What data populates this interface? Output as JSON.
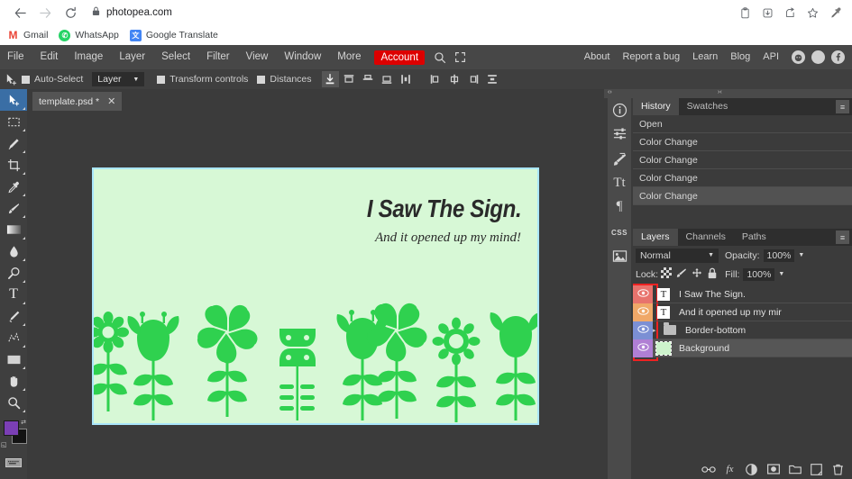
{
  "browser": {
    "url": "photopea.com",
    "nav": {
      "back_icon": "back-arrow-icon",
      "forward_icon": "forward-arrow-icon",
      "reload_icon": "reload-icon",
      "lock_icon": "lock-icon"
    },
    "omni_actions": [
      "clipboard-icon",
      "install-app-icon",
      "share-icon",
      "bookmark-star-icon",
      "eyedropper-icon"
    ],
    "bookmarks": [
      {
        "label": "Gmail",
        "icon": "gmail-icon",
        "glyph": "M"
      },
      {
        "label": "WhatsApp",
        "icon": "whatsapp-icon",
        "glyph": "✆"
      },
      {
        "label": "Google Translate",
        "icon": "google-translate-icon",
        "glyph": "文"
      }
    ]
  },
  "menubar": {
    "items": [
      "File",
      "Edit",
      "Image",
      "Layer",
      "Select",
      "Filter",
      "View",
      "Window",
      "More"
    ],
    "account": "Account",
    "account_color": "#dd0000",
    "icons": [
      "search-icon",
      "fullscreen-icon"
    ],
    "right_items": [
      "About",
      "Report a bug",
      "Learn",
      "Blog",
      "API"
    ],
    "social": [
      {
        "name": "reddit-icon",
        "glyph": "◉"
      },
      {
        "name": "twitter-icon",
        "glyph": "✈"
      },
      {
        "name": "facebook-icon",
        "glyph": "f"
      }
    ]
  },
  "options_bar": {
    "tool_icon": "move-tool-icon",
    "auto_select_label": "Auto-Select",
    "layer_scope": "Layer",
    "transform_controls_label": "Transform controls",
    "distances_label": "Distances",
    "align_icons": [
      "align-distribute-icon",
      "align-top-icon",
      "align-vcenter-icon",
      "align-bottom-icon",
      "distribute-vertical-icon",
      "align-left-icon",
      "align-hcenter-icon",
      "align-right-icon",
      "distribute-horizontal-icon"
    ]
  },
  "toolbar": {
    "tools": [
      {
        "name": "move-tool",
        "glyph": "✥",
        "active": true
      },
      {
        "name": "marquee-tool",
        "glyph": "▢",
        "active": false
      },
      {
        "name": "lasso-tool",
        "glyph": "✦",
        "active": false
      },
      {
        "name": "crop-tool",
        "glyph": "⌗",
        "active": false
      },
      {
        "name": "eyedropper-tool",
        "glyph": "✇",
        "active": false
      },
      {
        "name": "brush-tool",
        "glyph": "✎",
        "active": false
      },
      {
        "name": "gradient-tool",
        "glyph": "▦",
        "active": false
      },
      {
        "name": "blur-tool",
        "glyph": "💧",
        "active": false
      },
      {
        "name": "dodge-tool",
        "glyph": "🔍",
        "active": false
      },
      {
        "name": "text-tool",
        "glyph": "T",
        "active": false
      },
      {
        "name": "pen-tool",
        "glyph": "✒",
        "active": false
      },
      {
        "name": "shape-tool",
        "glyph": "✧",
        "active": false
      },
      {
        "name": "rectangle-tool",
        "glyph": "▬",
        "active": false
      },
      {
        "name": "hand-tool",
        "glyph": "✋",
        "active": false
      },
      {
        "name": "zoom-tool",
        "glyph": "🔎",
        "active": false
      }
    ],
    "foreground_color": "#7b3fb5",
    "background_color": "#131313",
    "keyboard_icon": "keyboard-icon"
  },
  "document": {
    "tab_label": "template.psd *",
    "close_glyph": "✕"
  },
  "canvas": {
    "headline": "I Saw The Sign.",
    "subline": "And it opened up my mind!",
    "background_color": "#d7f8d6",
    "flower_color": "#2fd14f",
    "selection_border_color": "#a9e6fb"
  },
  "right_panel": {
    "rail_icons": [
      "info-icon",
      "adjustments-icon",
      "brush-settings-icon",
      "character-icon",
      "paragraph-icon",
      "css-icon",
      "image-icon"
    ],
    "collapse_glyph": "›‹",
    "expand_glyph": "‹›",
    "menu_glyph": "≡",
    "history": {
      "tabs": [
        {
          "label": "History",
          "active": true
        },
        {
          "label": "Swatches",
          "active": false
        }
      ],
      "rows": [
        {
          "label": "Open",
          "selected": false
        },
        {
          "label": "Color Change",
          "selected": false
        },
        {
          "label": "Color Change",
          "selected": false
        },
        {
          "label": "Color Change",
          "selected": false
        },
        {
          "label": "Color Change",
          "selected": true
        }
      ]
    },
    "layers": {
      "tabs": [
        {
          "label": "Layers",
          "active": true
        },
        {
          "label": "Channels",
          "active": false
        },
        {
          "label": "Paths",
          "active": false
        }
      ],
      "blend_mode": "Normal",
      "opacity_label": "Opacity:",
      "opacity_value": "100%",
      "lock_label": "Lock:",
      "lock_icons": [
        "lock-transparency-icon",
        "lock-pixels-icon",
        "lock-position-icon",
        "lock-all-icon"
      ],
      "fill_label": "Fill:",
      "fill_value": "100%",
      "rows": [
        {
          "name": "I Saw The Sign.",
          "kind": "text",
          "eye_color": "#e8736d",
          "selected": false,
          "has_disclosure": false
        },
        {
          "name": "And it opened up my mir",
          "kind": "text",
          "eye_color": "#f0a868",
          "selected": false,
          "has_disclosure": false
        },
        {
          "name": "Border-bottom",
          "kind": "folder",
          "eye_color": "#7b8fd4",
          "selected": false,
          "has_disclosure": true
        },
        {
          "name": "Background",
          "kind": "image",
          "eye_color": "#b07fd4",
          "selected": true,
          "has_disclosure": false
        }
      ],
      "highlight_color": "#ee2222",
      "bottom_icons": [
        {
          "name": "link-layers-icon",
          "glyph": "∞"
        },
        {
          "name": "layer-effects-icon",
          "glyph": "ƒx"
        },
        {
          "name": "adjustment-layer-icon",
          "glyph": "◐"
        },
        {
          "name": "layer-mask-icon",
          "glyph": "▣"
        },
        {
          "name": "new-group-icon",
          "glyph": "🗀"
        },
        {
          "name": "new-layer-icon",
          "glyph": "🗋"
        },
        {
          "name": "delete-layer-icon",
          "glyph": "🗑"
        }
      ]
    }
  }
}
